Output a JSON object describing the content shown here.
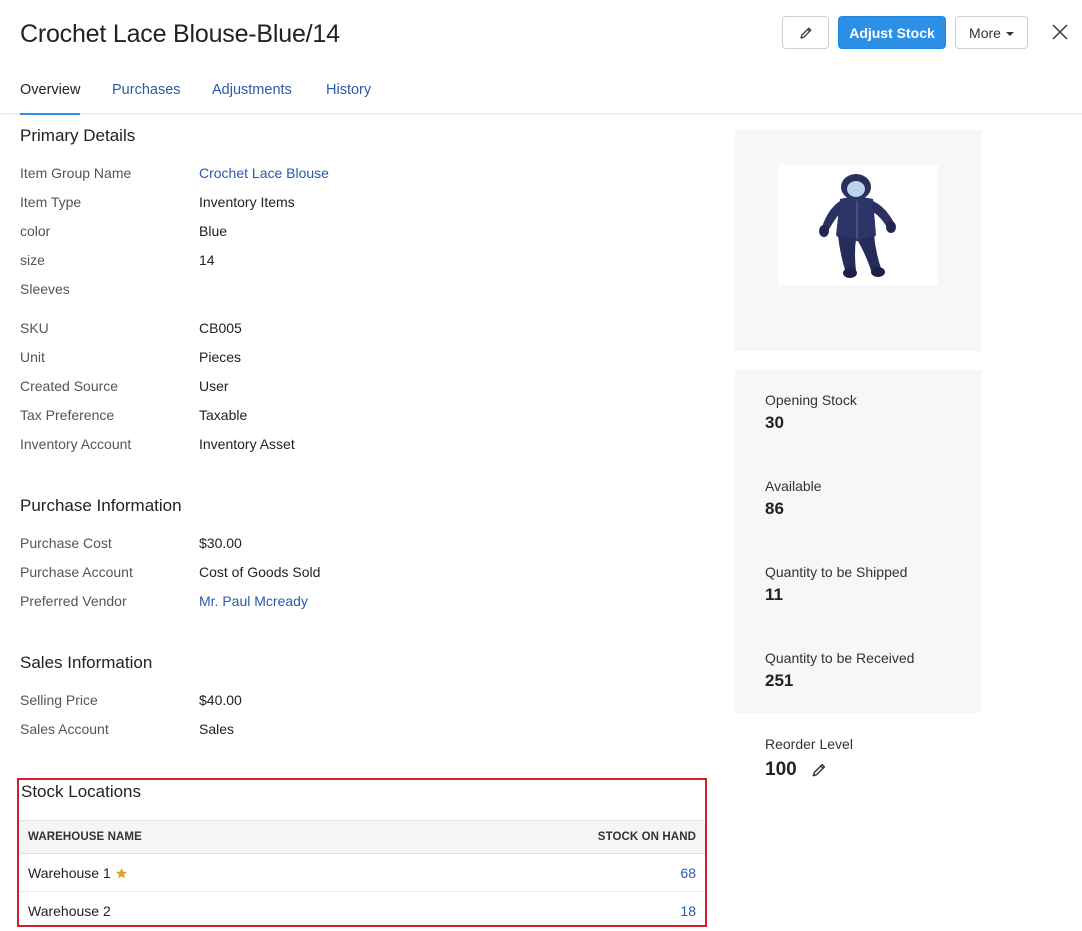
{
  "header": {
    "title": "Crochet Lace Blouse-Blue/14",
    "adjust_label": "Adjust Stock",
    "more_label": "More"
  },
  "tabs": [
    {
      "label": "Overview",
      "active": true
    },
    {
      "label": "Purchases"
    },
    {
      "label": "Adjustments"
    },
    {
      "label": "History"
    }
  ],
  "primary": {
    "title": "Primary Details",
    "rows": [
      {
        "label": "Item Group Name",
        "value": "Crochet Lace Blouse"
      },
      {
        "label": "Item Type",
        "value": "Inventory Items"
      },
      {
        "label": "color",
        "value": "Blue"
      },
      {
        "label": "size",
        "value": "14"
      },
      {
        "label": "Sleeves",
        "value": ""
      },
      {
        "label": "SKU",
        "value": "CB005"
      },
      {
        "label": "Unit",
        "value": "Pieces"
      },
      {
        "label": "Created Source",
        "value": "User"
      },
      {
        "label": "Tax Preference",
        "value": "Taxable"
      },
      {
        "label": "Inventory Account",
        "value": "Inventory Asset"
      }
    ]
  },
  "purchase": {
    "title": "Purchase Information",
    "rows": [
      {
        "label": "Purchase Cost",
        "value": "$30.00"
      },
      {
        "label": "Purchase Account",
        "value": "Cost of Goods Sold"
      },
      {
        "label": "Preferred Vendor",
        "value": "Mr. Paul Mcready"
      }
    ]
  },
  "sales": {
    "title": "Sales Information",
    "rows": [
      {
        "label": "Selling Price",
        "value": "$40.00"
      },
      {
        "label": "Sales Account",
        "value": "Sales"
      }
    ]
  },
  "stats": [
    {
      "label": "Opening Stock",
      "value": "30"
    },
    {
      "label": "Available",
      "value": "86"
    },
    {
      "label": "Quantity to be Shipped",
      "value": "11"
    },
    {
      "label": "Quantity to be Received",
      "value": "251"
    }
  ],
  "reorder": {
    "label": "Reorder Level",
    "value": "100"
  },
  "stock_locations": {
    "title": "Stock Locations",
    "col_warehouse": "WAREHOUSE NAME",
    "col_stock": "STOCK ON HAND",
    "rows": [
      {
        "name": "Warehouse 1",
        "qty": "68",
        "primary": true
      },
      {
        "name": "Warehouse 2",
        "qty": "18",
        "primary": false
      }
    ]
  },
  "colors": {
    "accent": "#2b90e6",
    "link": "#2b5aa8",
    "highlight_border": "#d0202a",
    "star": "#e0a020"
  },
  "icons": {
    "edit": "pencil-icon",
    "close": "close-icon",
    "more_caret": "caret-down-icon",
    "primary_warehouse": "star-icon"
  }
}
